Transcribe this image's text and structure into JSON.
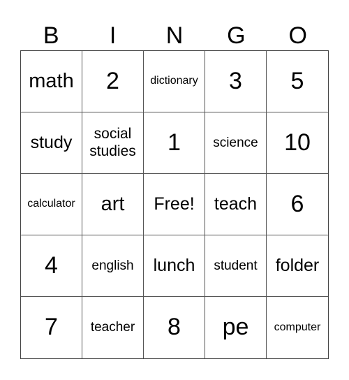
{
  "card": {
    "header": [
      "B",
      "I",
      "N",
      "G",
      "O"
    ],
    "rows": [
      [
        "math",
        "2",
        "dictionary",
        "3",
        "5"
      ],
      [
        "study",
        "social studies",
        "1",
        "science",
        "10"
      ],
      [
        "calculator",
        "art",
        "Free!",
        "teach",
        "6"
      ],
      [
        "4",
        "english",
        "lunch",
        "student",
        "folder"
      ],
      [
        "7",
        "teacher",
        "8",
        "pe",
        "computer"
      ]
    ],
    "free_space": "Free!"
  },
  "colors": {
    "background": "#ffffff",
    "text": "#000000",
    "grid_line": "#555555"
  }
}
